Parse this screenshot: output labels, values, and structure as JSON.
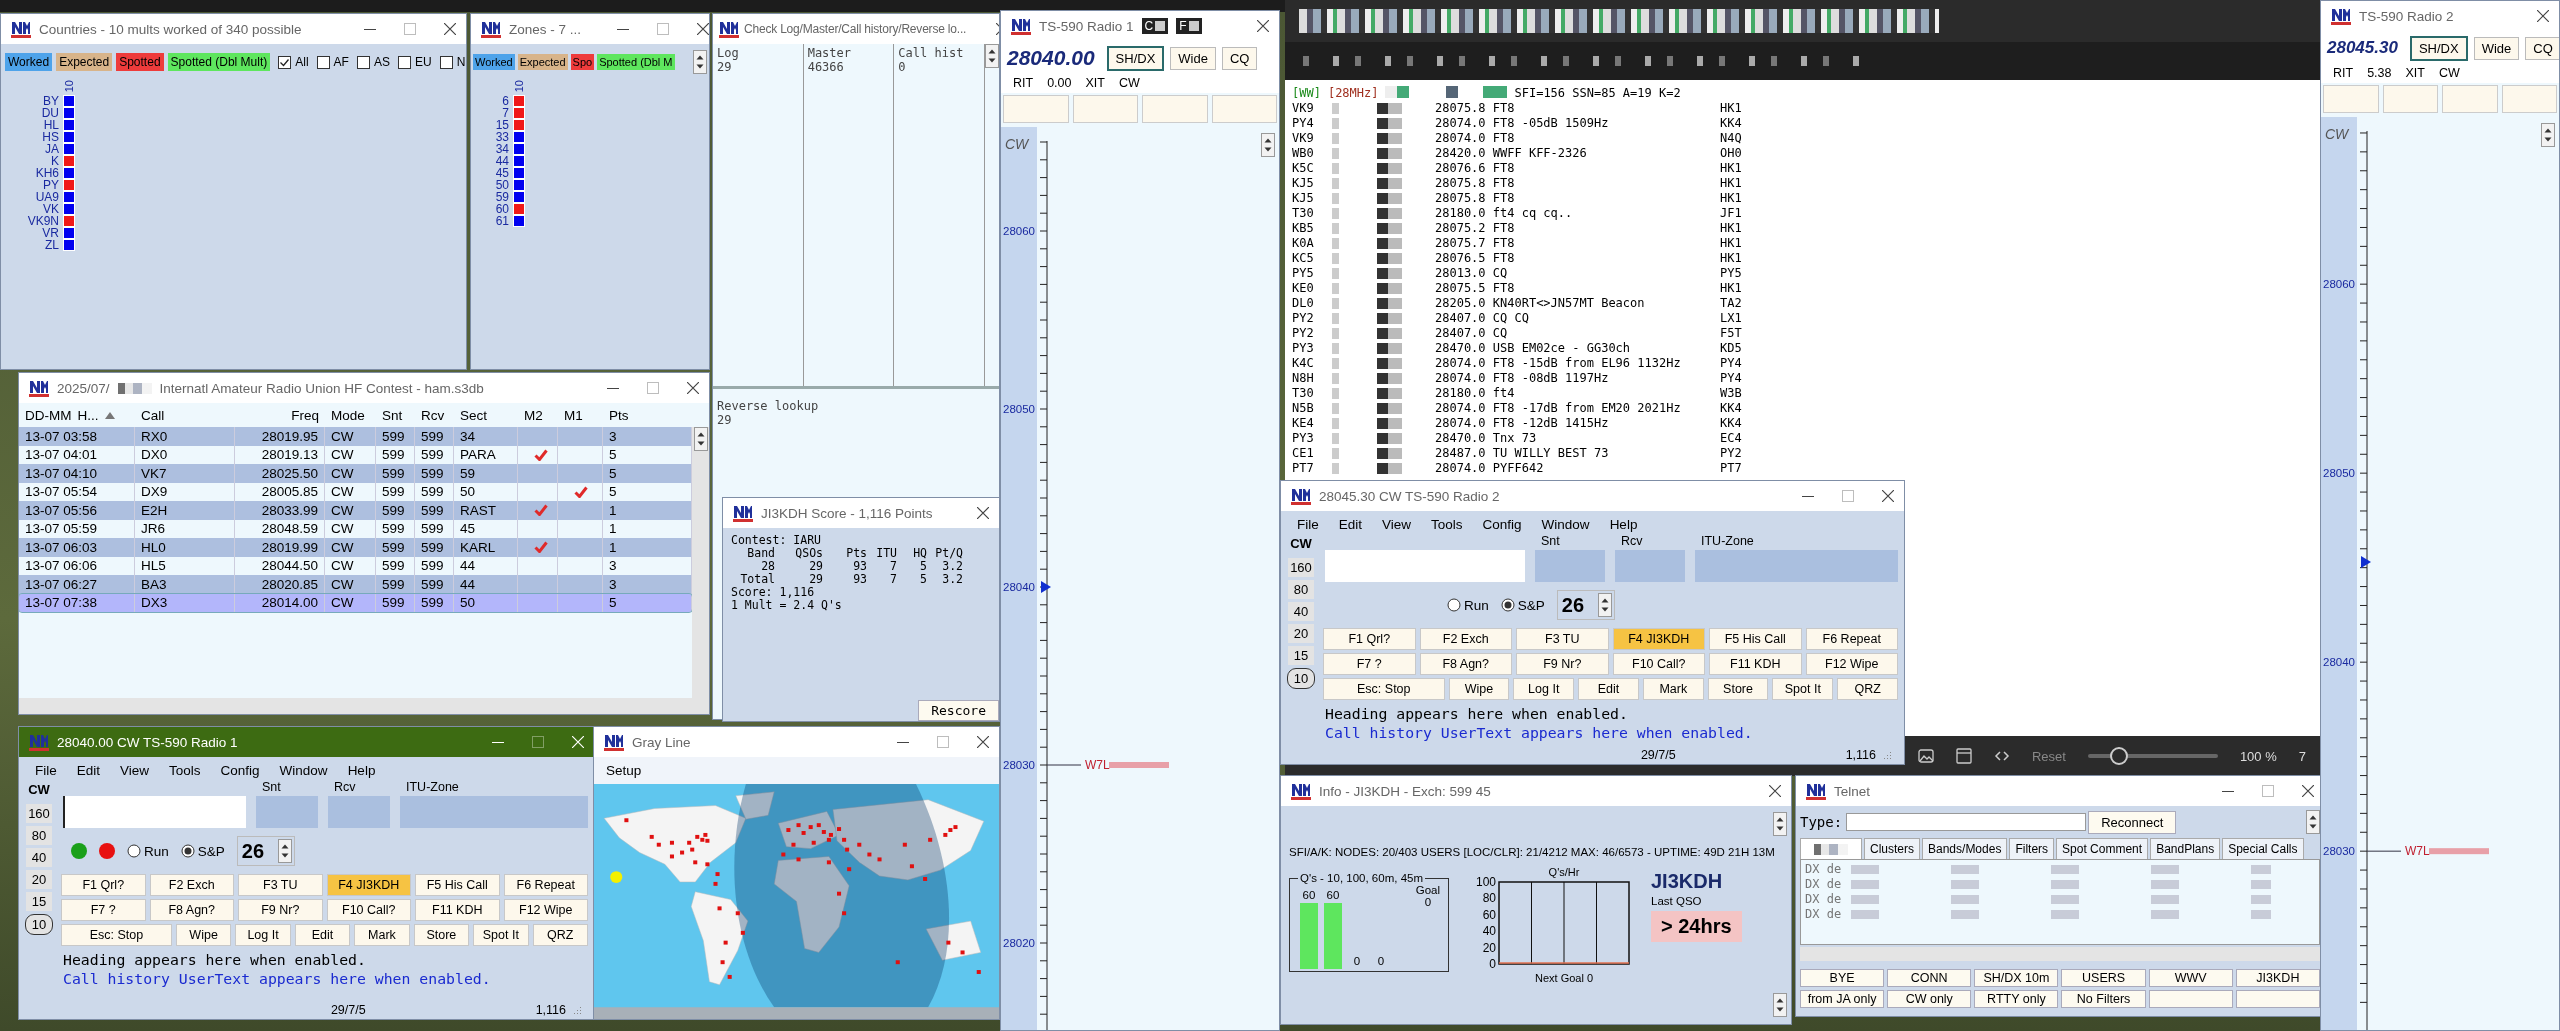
{
  "countries": {
    "title": "Countries - 10 mults worked of 340 possible",
    "legend": [
      {
        "label": "Worked",
        "color": "#4ea3ea"
      },
      {
        "label": "Expected",
        "color": "#d8b48a"
      },
      {
        "label": "Spotted",
        "color": "#ee3b3b"
      },
      {
        "label": "Spotted (Dbl Mult)",
        "color": "#5ee65e"
      }
    ],
    "filters": [
      {
        "label": "All",
        "checked": true
      },
      {
        "label": "AF",
        "checked": false
      },
      {
        "label": "AS",
        "checked": false
      },
      {
        "label": "EU",
        "checked": false
      },
      {
        "label": "N",
        "checked": false
      }
    ],
    "column": "10",
    "items": [
      {
        "label": "BY",
        "color": "#0000f0"
      },
      {
        "label": "DU",
        "color": "#0000f0"
      },
      {
        "label": "HL",
        "color": "#0000f0"
      },
      {
        "label": "HS",
        "color": "#0000f0"
      },
      {
        "label": "JA",
        "color": "#0000f0"
      },
      {
        "label": "K",
        "color": "#f01818"
      },
      {
        "label": "KH6",
        "color": "#0000f0"
      },
      {
        "label": "PY",
        "color": "#f01818"
      },
      {
        "label": "UA9",
        "color": "#0000f0"
      },
      {
        "label": "VK",
        "color": "#0000f0"
      },
      {
        "label": "VK9N",
        "color": "#f01818"
      },
      {
        "label": "VR",
        "color": "#0000f0"
      },
      {
        "label": "ZL",
        "color": "#0000f0"
      }
    ]
  },
  "zones": {
    "title": "Zones - 7 ...",
    "legend": [
      {
        "label": "Worked",
        "color": "#4ea3ea"
      },
      {
        "label": "Expected",
        "color": "#d8b48a"
      },
      {
        "label": "Spo",
        "color": "#ee3b3b"
      },
      {
        "label": "Spotted (Dbl M",
        "color": "#5ee65e"
      }
    ],
    "column": "10",
    "items": [
      {
        "label": "6",
        "color": "#f01818"
      },
      {
        "label": "7",
        "color": "#f01818"
      },
      {
        "label": "15",
        "color": "#f01818"
      },
      {
        "label": "33",
        "color": "#0000f0"
      },
      {
        "label": "34",
        "color": "#0000f0"
      },
      {
        "label": "44",
        "color": "#0000f0"
      },
      {
        "label": "45",
        "color": "#0000f0"
      },
      {
        "label": "50",
        "color": "#0000f0"
      },
      {
        "label": "59",
        "color": "#0000f0"
      },
      {
        "label": "60",
        "color": "#f01818"
      },
      {
        "label": "61",
        "color": "#0000f0"
      }
    ]
  },
  "check_log": {
    "title": "Check Log/Master/Call history/Reverse lo...",
    "columns": [
      {
        "heading": "Log",
        "value": "29"
      },
      {
        "heading": "Master",
        "value": "46366"
      },
      {
        "heading": "Call hist",
        "value": "0"
      }
    ],
    "reverse_lookup": {
      "heading": "Reverse lookup",
      "value": "29"
    }
  },
  "log": {
    "title_date": "2025/07/",
    "title": "Internatl Amateur Radio Union HF Contest - ham.s3db",
    "columns": [
      "DD-MM",
      "H...",
      "Call",
      "Freq",
      "Mode",
      "Snt",
      "Rcv",
      "Sect",
      "M2",
      "M1",
      "Pts"
    ],
    "rows": [
      {
        "time": "13-07 03:58",
        "call": "RX0",
        "freq": "28019.95",
        "mode": "CW",
        "snt": "599",
        "rcv": "599",
        "sect": "34",
        "m2": false,
        "m1": false,
        "pts": "3",
        "selected": false
      },
      {
        "time": "13-07 04:01",
        "call": "DX0",
        "freq": "28019.13",
        "mode": "CW",
        "snt": "599",
        "rcv": "599",
        "sect": "PARA",
        "m2": true,
        "m1": false,
        "pts": "5",
        "selected": false
      },
      {
        "time": "13-07 04:10",
        "call": "VK7",
        "freq": "28025.50",
        "mode": "CW",
        "snt": "599",
        "rcv": "599",
        "sect": "59",
        "m2": false,
        "m1": false,
        "pts": "5",
        "selected": false
      },
      {
        "time": "13-07 05:54",
        "call": "DX9",
        "freq": "28005.85",
        "mode": "CW",
        "snt": "599",
        "rcv": "599",
        "sect": "50",
        "m2": false,
        "m1": true,
        "pts": "5",
        "selected": false
      },
      {
        "time": "13-07 05:56",
        "call": "E2H",
        "freq": "28033.99",
        "mode": "CW",
        "snt": "599",
        "rcv": "599",
        "sect": "RAST",
        "m2": true,
        "m1": false,
        "pts": "1",
        "selected": false
      },
      {
        "time": "13-07 05:59",
        "call": "JR6",
        "freq": "28048.59",
        "mode": "CW",
        "snt": "599",
        "rcv": "599",
        "sect": "45",
        "m2": false,
        "m1": false,
        "pts": "1",
        "selected": false
      },
      {
        "time": "13-07 06:03",
        "call": "HL0",
        "freq": "28019.99",
        "mode": "CW",
        "snt": "599",
        "rcv": "599",
        "sect": "KARL",
        "m2": true,
        "m1": false,
        "pts": "1",
        "selected": false
      },
      {
        "time": "13-07 06:06",
        "call": "HL5",
        "freq": "28044.50",
        "mode": "CW",
        "snt": "599",
        "rcv": "599",
        "sect": "44",
        "m2": false,
        "m1": false,
        "pts": "3",
        "selected": false
      },
      {
        "time": "13-07 06:27",
        "call": "BA3",
        "freq": "28020.85",
        "mode": "CW",
        "snt": "599",
        "rcv": "599",
        "sect": "44",
        "m2": false,
        "m1": false,
        "pts": "3",
        "selected": false
      },
      {
        "time": "13-07 07:38",
        "call": "DX3",
        "freq": "28014.00",
        "mode": "CW",
        "snt": "599",
        "rcv": "599",
        "sect": "50",
        "m2": false,
        "m1": false,
        "pts": "5",
        "selected": true
      }
    ]
  },
  "score": {
    "title": "JI3KDH Score - 1,116 Points",
    "contest": "Contest: IARU",
    "columns": [
      "Band",
      "QSOs",
      "Pts",
      "ITU",
      "HQ",
      "Pt/Q"
    ],
    "rows": [
      [
        "28",
        "29",
        "93",
        "7",
        "5",
        "3.2"
      ],
      [
        "Total",
        "29",
        "93",
        "7",
        "5",
        "3.2"
      ]
    ],
    "total_score": "Score: 1,116",
    "mult_ratio": "1 Mult = 2.4 Q's",
    "button": "Rescore"
  },
  "radio1_entry": {
    "title": "28040.00 CW TS-590 Radio 1",
    "active": true,
    "menu": [
      "File",
      "Edit",
      "View",
      "Tools",
      "Config",
      "Window",
      "Help"
    ],
    "mode": "CW",
    "bands": [
      {
        "label": "160",
        "selected": false
      },
      {
        "label": "80",
        "selected": false
      },
      {
        "label": "40",
        "selected": false
      },
      {
        "label": "20",
        "selected": false
      },
      {
        "label": "15",
        "selected": false
      },
      {
        "label": "10",
        "selected": true
      }
    ],
    "fields": [
      "Snt",
      "Rcv",
      "ITU-Zone"
    ],
    "leds": [
      {
        "color": "#1aa01a"
      },
      {
        "color": "#e81010"
      }
    ],
    "modes": [
      {
        "label": "Run",
        "selected": false
      },
      {
        "label": "S&P",
        "selected": true
      }
    ],
    "spinner": "26",
    "keys": [
      [
        {
          "label": "F1 Qrl?",
          "active": false
        },
        {
          "label": "F2 Exch",
          "active": false
        },
        {
          "label": "F3 TU",
          "active": false
        },
        {
          "label": "F4 JI3KDH",
          "active": true
        },
        {
          "label": "F5 His Call",
          "active": false
        },
        {
          "label": "F6 Repeat",
          "active": false
        }
      ],
      [
        {
          "label": "F7 ?",
          "active": false
        },
        {
          "label": "F8 Agn?",
          "active": false
        },
        {
          "label": "F9 Nr?",
          "active": false
        },
        {
          "label": "F10 Call?",
          "active": false
        },
        {
          "label": "F11 KDH",
          "active": false
        },
        {
          "label": "F12 Wipe",
          "active": false
        }
      ],
      [
        {
          "label": "Esc: Stop",
          "active": false
        },
        {
          "label": "Wipe",
          "active": false
        },
        {
          "label": "Log It",
          "active": false
        },
        {
          "label": "Edit",
          "active": false
        },
        {
          "label": "Mark",
          "active": false
        },
        {
          "label": "Store",
          "active": false
        },
        {
          "label": "Spot It",
          "active": false
        },
        {
          "label": "QRZ",
          "active": false
        }
      ]
    ],
    "heading": "Heading appears here when enabled.",
    "user_text": "Call history UserText appears here when enabled.",
    "status": "29/7/5",
    "score": "1,116"
  },
  "gray_line": {
    "title": "Gray Line",
    "menu": [
      "Setup"
    ]
  },
  "radio1_bandmap": {
    "title": "TS-590 Radio 1",
    "title_buttons": [
      "C",
      "F"
    ],
    "freq": "28040.00",
    "buttons": [
      {
        "label": "SH/DX",
        "selected": true
      },
      {
        "label": "Wide",
        "selected": false
      },
      {
        "label": "CQ",
        "selected": false
      }
    ],
    "rit_label": "RIT",
    "rit": "0.00",
    "xit_label": "XIT",
    "mode": "CW",
    "strip_mode": "CW",
    "ticks": [
      "28060",
      "28050",
      "28040",
      "28030",
      "28020"
    ],
    "spots": [
      {
        "call": "W7L"
      }
    ]
  },
  "spots": {
    "header": {
      "scope": "[WW]",
      "band": "[28MHz]",
      "conditions": "SFI=156 SSN=85 A=19 K=2"
    },
    "rows": [
      {
        "call": "VK9",
        "info": "28075.8 FT8",
        "spotter": "HK1"
      },
      {
        "call": "PY4",
        "info": "28074.0 FT8 -05dB 1509Hz",
        "spotter": "KK4"
      },
      {
        "call": "VK9",
        "info": "28074.0 FT8",
        "spotter": "N4Q"
      },
      {
        "call": "WB0",
        "info": "28420.0 WWFF KFF-2326",
        "spotter": "OH0"
      },
      {
        "call": "K5C",
        "info": "28076.6 FT8",
        "spotter": "HK1"
      },
      {
        "call": "KJ5",
        "info": "28075.8 FT8",
        "spotter": "HK1"
      },
      {
        "call": "KJ5",
        "info": "28075.8 FT8",
        "spotter": "HK1"
      },
      {
        "call": "T30",
        "info": "28180.0 ft4 cq cq..",
        "spotter": "JF1"
      },
      {
        "call": "KB5",
        "info": "28075.2 FT8",
        "spotter": "HK1"
      },
      {
        "call": "K0A",
        "info": "28075.7 FT8",
        "spotter": "HK1"
      },
      {
        "call": "KC5",
        "info": "28076.5 FT8",
        "spotter": "HK1"
      },
      {
        "call": "PY5",
        "info": "28013.0 CQ",
        "spotter": "PY5"
      },
      {
        "call": "KE0",
        "info": "28075.5 FT8",
        "spotter": "HK1"
      },
      {
        "call": "DL0",
        "info": "28205.0 KN40RT<>JN57MT Beacon",
        "spotter": "TA2"
      },
      {
        "call": "PY2",
        "info": "28407.0 CQ CQ",
        "spotter": "LX1"
      },
      {
        "call": "PY2",
        "info": "28407.0 CQ",
        "spotter": "F5T"
      },
      {
        "call": "PY3",
        "info": "28470.0 USB EM02ce - GG30ch",
        "spotter": "KD5"
      },
      {
        "call": "K4C",
        "info": "28074.0 FT8 -15dB from EL96 1132Hz",
        "spotter": "PY4"
      },
      {
        "call": "N8H",
        "info": "28074.0 FT8 -08dB 1197Hz",
        "spotter": "PY4"
      },
      {
        "call": "T30",
        "info": "28180.0 ft4",
        "spotter": "W3B"
      },
      {
        "call": "N5B",
        "info": "28074.0 FT8 -17dB from EM20 2021Hz",
        "spotter": "KK4"
      },
      {
        "call": "KE4",
        "info": "28074.0 FT8 -12dB 1415Hz",
        "spotter": "KK4"
      },
      {
        "call": "PY3",
        "info": "28470.0 Tnx 73",
        "spotter": "EC4"
      },
      {
        "call": "CE1",
        "info": "28487.0 TU WILLY BEST 73",
        "spotter": "PY2"
      },
      {
        "call": "PT7",
        "info": "28074.0 PYFF642",
        "spotter": "PT7"
      }
    ],
    "zoom": {
      "reset": "Reset",
      "level": 0.2,
      "reading": "100 %",
      "page": "7"
    }
  },
  "radio2_entry": {
    "title": "28045.30 CW TS-590 Radio 2",
    "active": false,
    "menu": [
      "File",
      "Edit",
      "View",
      "Tools",
      "Config",
      "Window",
      "Help"
    ],
    "mode": "CW",
    "bands": [
      {
        "label": "160",
        "selected": false
      },
      {
        "label": "80",
        "selected": false
      },
      {
        "label": "40",
        "selected": false
      },
      {
        "label": "20",
        "selected": false
      },
      {
        "label": "15",
        "selected": false
      },
      {
        "label": "10",
        "selected": true
      }
    ],
    "fields": [
      "Snt",
      "Rcv",
      "ITU-Zone"
    ],
    "modes": [
      {
        "label": "Run",
        "selected": false
      },
      {
        "label": "S&P",
        "selected": true
      }
    ],
    "spinner": "26",
    "keys": [
      [
        {
          "label": "F1 Qrl?",
          "active": false
        },
        {
          "label": "F2 Exch",
          "active": false
        },
        {
          "label": "F3 TU",
          "active": false
        },
        {
          "label": "F4 JI3KDH",
          "active": true
        },
        {
          "label": "F5 His Call",
          "active": false
        },
        {
          "label": "F6 Repeat",
          "active": false
        }
      ],
      [
        {
          "label": "F7 ?",
          "active": false
        },
        {
          "label": "F8 Agn?",
          "active": false
        },
        {
          "label": "F9 Nr?",
          "active": false
        },
        {
          "label": "F10 Call?",
          "active": false
        },
        {
          "label": "F11 KDH",
          "active": false
        },
        {
          "label": "F12 Wipe",
          "active": false
        }
      ],
      [
        {
          "label": "Esc: Stop",
          "active": false
        },
        {
          "label": "Wipe",
          "active": false
        },
        {
          "label": "Log It",
          "active": false
        },
        {
          "label": "Edit",
          "active": false
        },
        {
          "label": "Mark",
          "active": false
        },
        {
          "label": "Store",
          "active": false
        },
        {
          "label": "Spot It",
          "active": false
        },
        {
          "label": "QRZ",
          "active": false
        }
      ]
    ],
    "heading": "Heading appears here when enabled.",
    "user_text": "Call history UserText appears here when enabled.",
    "status": "29/7/5",
    "score": "1,116"
  },
  "info": {
    "title": "Info - JI3KDH - Exch: 599 45",
    "cluster_info": "SFI/A/K: NODES: 20/403 USERS [LOC/CLR]: 21/4212 MAX: 46/6573 - UPTIME: 49D 21H 13M",
    "q_group": {
      "legend": "Q's - 10, 100, 60m, 45m",
      "bars": [
        "60",
        "60",
        "0",
        "0"
      ],
      "goal_label": "Goal",
      "goal": "0"
    },
    "rate_chart": {
      "title": "Q's/Hr",
      "axis_labels": [
        "100",
        "80",
        "60",
        "40",
        "20",
        "0"
      ],
      "footer": "Next Goal 0"
    },
    "call": "JI3KDH",
    "last_qso_label": "Last QSO",
    "last_qso": "> 24hrs"
  },
  "telnet": {
    "title": "Telnet",
    "type_label": "Type:",
    "reconnect": "Reconnect",
    "tabs": [
      {
        "label": "Clusters",
        "selected": false
      },
      {
        "label": "Bands/Modes",
        "selected": false
      },
      {
        "label": "Filters",
        "selected": false
      },
      {
        "label": "Spot Comment",
        "selected": false
      },
      {
        "label": "BandPlans",
        "selected": false
      },
      {
        "label": "Special Calls",
        "selected": false
      }
    ],
    "lines": [
      "DX de",
      "DX de",
      "DX de",
      "DX de"
    ],
    "buttons": [
      [
        "BYE",
        "CONN",
        "SH/DX 10m",
        "USERS",
        "WWV",
        "JI3KDH"
      ],
      [
        "from JA only",
        "CW only",
        "RTTY only",
        "No Filters"
      ]
    ]
  },
  "radio2_bandmap": {
    "title": "TS-590 Radio 2",
    "freq": "28045.30",
    "buttons": [
      {
        "label": "SH/DX",
        "selected": true
      },
      {
        "label": "Wide",
        "selected": false
      },
      {
        "label": "CQ",
        "selected": false
      }
    ],
    "rit_label": "RIT",
    "rit": "5.38",
    "xit_label": "XIT",
    "mode": "CW",
    "strip_mode": "CW",
    "ticks": [
      "28060",
      "28050",
      "28040",
      "28030"
    ],
    "spots": [
      {
        "call": "W7L"
      }
    ]
  }
}
